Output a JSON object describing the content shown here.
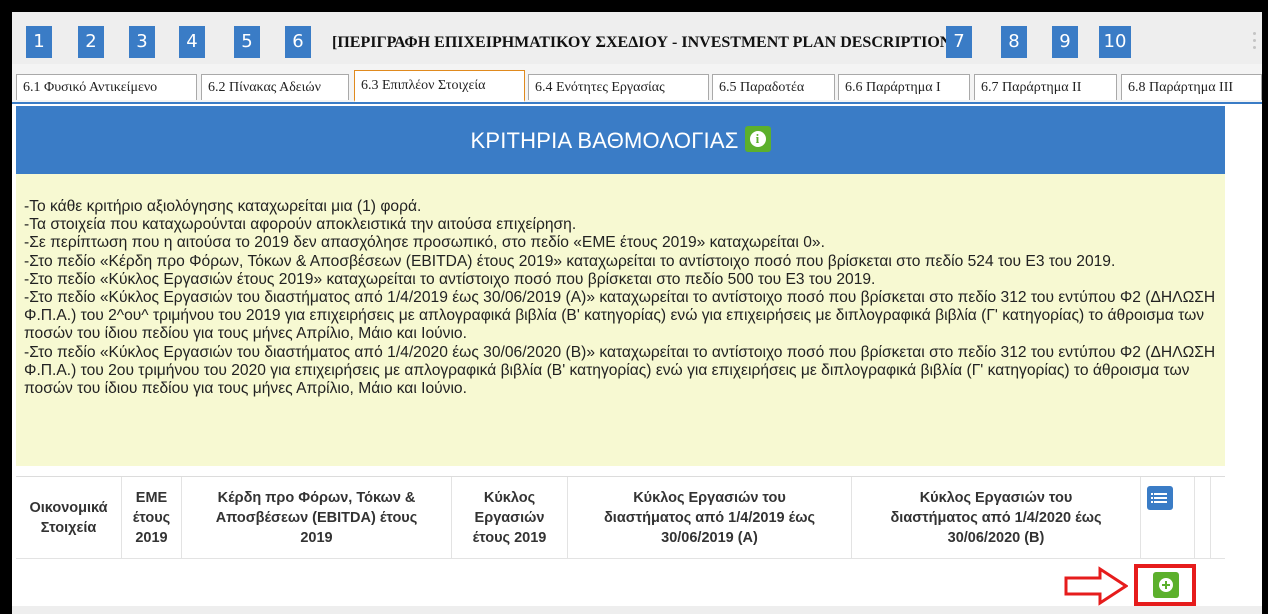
{
  "steps": [
    "1",
    "2",
    "3",
    "4",
    "5",
    "6",
    "7",
    "8",
    "9",
    "10"
  ],
  "step_title": "[ΠΕΡΙΓΡΑΦΗ ΕΠΙΧΕΙΡΗΜΑΤΙΚΟΥ ΣΧΕΔΙΟΥ - INVESTMENT PLAN DESCRIPTION]",
  "tabs": [
    {
      "label": "6.1 Φυσικό Αντικείμενο",
      "active": false
    },
    {
      "label": "6.2 Πίνακας Αδειών",
      "active": false
    },
    {
      "label": "6.3 Επιπλέον Στοιχεία",
      "active": true
    },
    {
      "label": "6.4 Ενότητες Εργασίας",
      "active": false
    },
    {
      "label": "6.5 Παραδοτέα",
      "active": false
    },
    {
      "label": "6.6 Παράρτημα I",
      "active": false
    },
    {
      "label": "6.7 Παράρτημα II",
      "active": false
    },
    {
      "label": "6.8 Παράρτημα III",
      "active": false
    }
  ],
  "section_title": "ΚΡΙΤΗΡΙΑ ΒΑΘΜΟΛΟΓΙΑΣ",
  "instructions": [
    "-Το κάθε κριτήριο αξιολόγησης καταχωρείται μια (1) φορά.",
    "-Τα στοιχεία που καταχωρούνται αφορούν αποκλειστικά την αιτούσα επιχείρηση.",
    "-Σε περίπτωση που η αιτούσα το 2019 δεν απασχόλησε προσωπικό, στο πεδίο «ΕΜΕ έτους 2019» καταχωρείται 0».",
    "-Στο πεδίο «Κέρδη προ Φόρων, Τόκων & Αποσβέσεων (EBITDA) έτους 2019» καταχωρείται το αντίστοιχο ποσό που βρίσκεται στο πεδίο 524 του Ε3 του 2019.",
    "-Στο πεδίο «Κύκλος Εργασιών έτους 2019» καταχωρείται το αντίστοιχο ποσό που βρίσκεται στο πεδίο 500 του Ε3 του 2019.",
    "-Στο πεδίο «Κύκλος Εργασιών του διαστήματος από 1/4/2019 έως 30/06/2019 (Α)» καταχωρείται το αντίστοιχο ποσό που βρίσκεται στο πεδίο 312 του εντύπου Φ2 (ΔΗΛΩΣΗ Φ.Π.Α.) του 2^ου^ τριμήνου του 2019 για επιχειρήσεις με απλογραφικά βιβλία (Β' κατηγορίας) ενώ για επιχειρήσεις με διπλογραφικά βιβλία (Γ' κατηγορίας) το άθροισμα των ποσών του ίδιου πεδίου για τους μήνες Απρίλιο, Μάιο και Ιούνιο.",
    "-Στο πεδίο «Κύκλος Εργασιών του διαστήματος από 1/4/2020 έως 30/06/2020 (Β)» καταχωρείται το αντίστοιχο ποσό που βρίσκεται στο πεδίο 312 του εντύπου Φ2 (ΔΗΛΩΣΗ Φ.Π.Α.) του 2ου τριμήνου του 2020 για επιχειρήσεις με απλογραφικά βιβλία (Β' κατηγορίας) ενώ για επιχειρήσεις με διπλογραφικά βιβλία (Γ' κατηγορίας) το άθροισμα των ποσών του ίδιου πεδίου για τους μήνες Απρίλιο, Μάιο και Ιούνιο."
  ],
  "table": {
    "headers": [
      [
        "Οικονομικά",
        "Στοιχεία"
      ],
      [
        "ΕΜΕ",
        "έτους",
        "2019"
      ],
      [
        "Κέρδη προ Φόρων, Τόκων &",
        "Αποσβέσεων (EBITDA) έτους",
        "2019"
      ],
      [
        "Κύκλος",
        "Εργασιών",
        "έτους 2019"
      ],
      [
        "Κύκλος Εργασιών του",
        "διαστήματος από 1/4/2019 έως",
        "30/06/2019 (Α)"
      ],
      [
        "Κύκλος Εργασιών του",
        "διαστήματος από 1/4/2020 έως",
        "30/06/2020 (Β)"
      ]
    ],
    "rows": []
  },
  "icons": {
    "info": "info-icon",
    "list": "list-icon",
    "add": "add-circle-icon",
    "arrow": "right-arrow-icon",
    "menu": "kebab-menu-icon"
  },
  "colors": {
    "accent_blue": "#3a7cc6",
    "info_green": "#5cb02c",
    "highlight_red": "#e61c1c",
    "instruction_bg": "#f7f9d2",
    "active_tab_border": "#e08a1e"
  }
}
